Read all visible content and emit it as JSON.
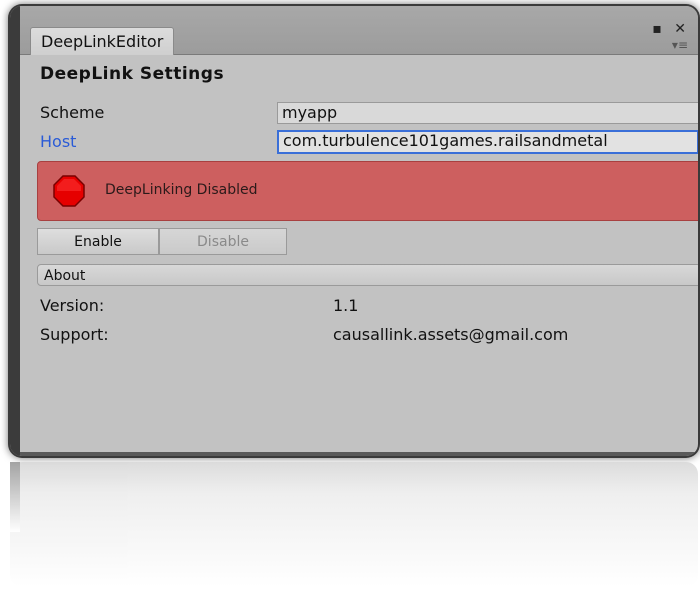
{
  "window": {
    "tab_title": "DeepLinkEditor",
    "controls": "▪ ✕",
    "menu_icon": "▾≡"
  },
  "settings": {
    "title": "DeepLink Settings",
    "scheme_label": "Scheme",
    "scheme_value": "myapp",
    "host_label": "Host",
    "host_value": "com.turbulence101games.railsandmetal"
  },
  "status": {
    "text": "DeepLinking Disabled",
    "icon": "stop-icon",
    "color": "#cd5f5f"
  },
  "buttons": {
    "enable": "Enable",
    "disable": "Disable"
  },
  "about": {
    "header": "About",
    "version_label": "Version:",
    "version_value": "1.1",
    "support_label": "Support:",
    "support_value": "causallink.assets@gmail.com"
  }
}
